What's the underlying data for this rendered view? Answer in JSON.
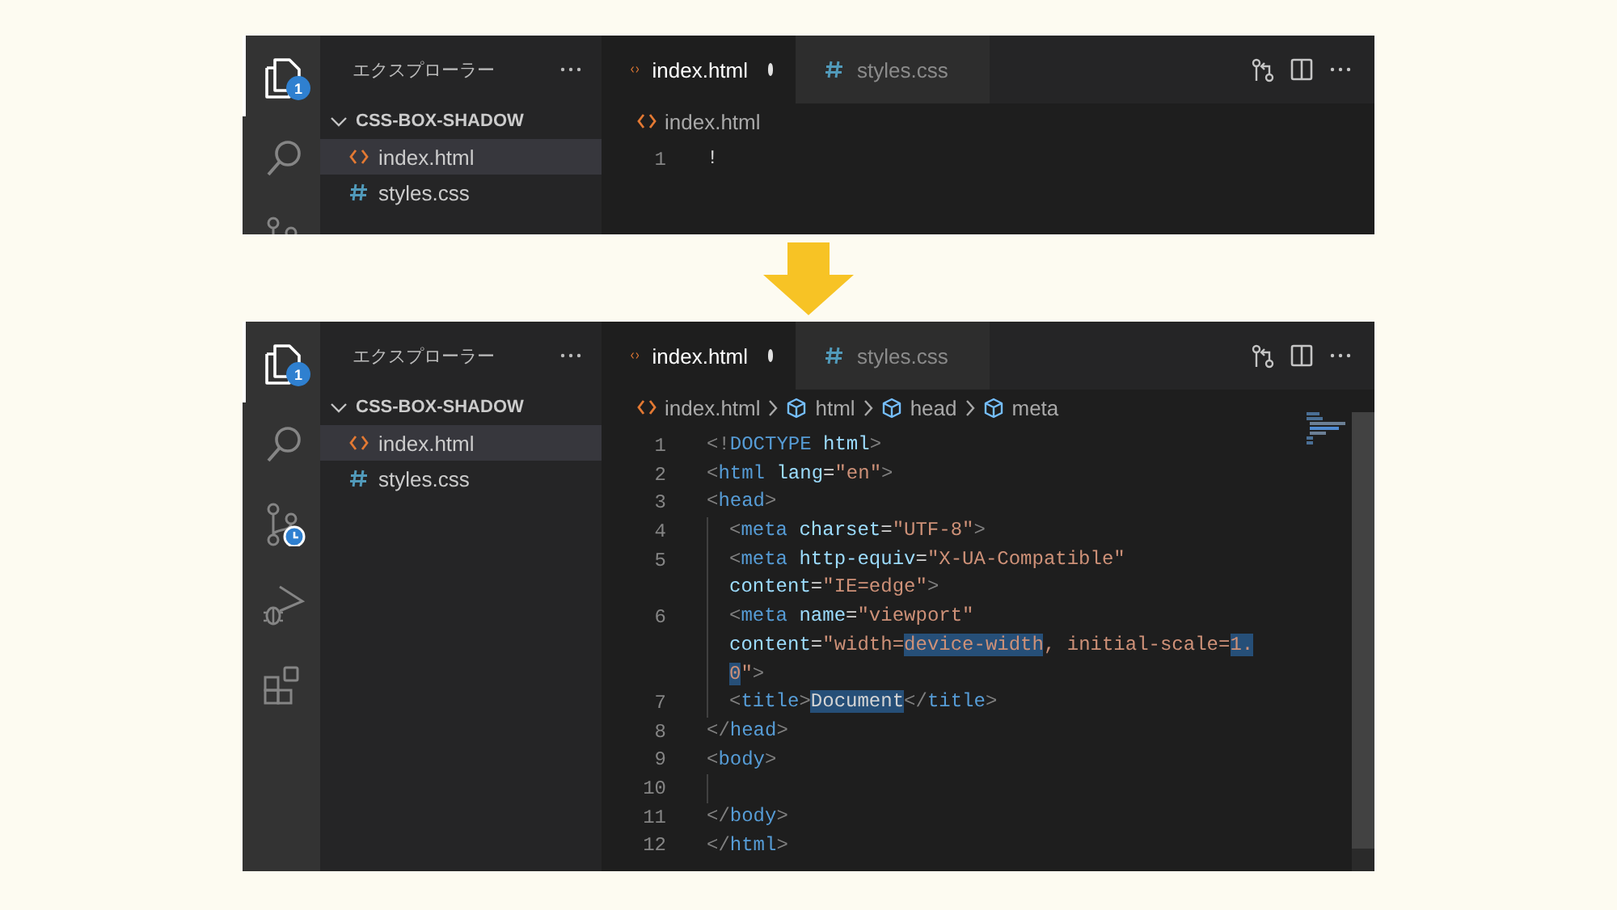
{
  "panels": [
    {
      "activity": [
        {
          "kind": "files",
          "selected": true,
          "badge": "1"
        },
        {
          "kind": "search",
          "selected": false
        },
        {
          "kind": "source-control",
          "selected": false
        }
      ],
      "explorer": {
        "title": "エクスプローラー",
        "folder": "CSS-BOX-SHADOW",
        "expanded": true,
        "files": [
          {
            "name": "index.html",
            "kind": "html",
            "selected": true
          },
          {
            "name": "styles.css",
            "kind": "css",
            "selected": false
          }
        ]
      },
      "tabs": [
        {
          "label": "index.html",
          "kind": "html",
          "selected": true,
          "modified": true
        },
        {
          "label": "styles.css",
          "kind": "css",
          "selected": false,
          "modified": false
        }
      ],
      "breadcrumb": [
        {
          "label": "index.html",
          "kind": "html"
        }
      ],
      "lines": [
        {
          "number": "1",
          "rows": [
            {
              "indented": false,
              "tokens": [
                {
                  "text": "!",
                  "kind": "text",
                  "highlighted": false
                }
              ]
            }
          ]
        }
      ]
    },
    {
      "activity": [
        {
          "kind": "files",
          "selected": true,
          "badge": "1"
        },
        {
          "kind": "search",
          "selected": false
        },
        {
          "kind": "source-control",
          "selected": false
        },
        {
          "kind": "debug",
          "selected": false
        },
        {
          "kind": "extensions",
          "selected": false
        }
      ],
      "explorer": {
        "title": "エクスプローラー",
        "folder": "CSS-BOX-SHADOW",
        "expanded": true,
        "files": [
          {
            "name": "index.html",
            "kind": "html",
            "selected": true
          },
          {
            "name": "styles.css",
            "kind": "css",
            "selected": false
          }
        ]
      },
      "tabs": [
        {
          "label": "index.html",
          "kind": "html",
          "selected": true,
          "modified": true
        },
        {
          "label": "styles.css",
          "kind": "css",
          "selected": false,
          "modified": false
        }
      ],
      "breadcrumb": [
        {
          "label": "index.html",
          "kind": "html"
        },
        {
          "label": "html",
          "kind": "element"
        },
        {
          "label": "head",
          "kind": "element"
        },
        {
          "label": "meta",
          "kind": "element"
        }
      ],
      "lines": [
        {
          "number": "1",
          "rows": [
            {
              "indented": false,
              "tokens": [
                {
                  "text": "<!",
                  "kind": "punct",
                  "highlighted": false
                },
                {
                  "text": "DOCTYPE",
                  "kind": "tag",
                  "highlighted": false
                },
                {
                  "text": " html",
                  "kind": "attr",
                  "highlighted": false
                },
                {
                  "text": ">",
                  "kind": "punct",
                  "highlighted": false
                }
              ]
            }
          ]
        },
        {
          "number": "2",
          "rows": [
            {
              "indented": false,
              "tokens": [
                {
                  "text": "<",
                  "kind": "punct",
                  "highlighted": false
                },
                {
                  "text": "html",
                  "kind": "tag",
                  "highlighted": false
                },
                {
                  "text": " lang",
                  "kind": "attr",
                  "highlighted": false
                },
                {
                  "text": "=",
                  "kind": "text",
                  "highlighted": false
                },
                {
                  "text": "\"en\"",
                  "kind": "string",
                  "highlighted": false
                },
                {
                  "text": ">",
                  "kind": "punct",
                  "highlighted": false
                }
              ]
            }
          ]
        },
        {
          "number": "3",
          "rows": [
            {
              "indented": false,
              "tokens": [
                {
                  "text": "<",
                  "kind": "punct",
                  "highlighted": false
                },
                {
                  "text": "head",
                  "kind": "tag",
                  "highlighted": false
                },
                {
                  "text": ">",
                  "kind": "punct",
                  "highlighted": false
                }
              ]
            }
          ]
        },
        {
          "number": "4",
          "rows": [
            {
              "indented": true,
              "tokens": [
                {
                  "text": "<",
                  "kind": "punct",
                  "highlighted": false
                },
                {
                  "text": "meta",
                  "kind": "tag",
                  "highlighted": false
                },
                {
                  "text": " charset",
                  "kind": "attr",
                  "highlighted": false
                },
                {
                  "text": "=",
                  "kind": "text",
                  "highlighted": false
                },
                {
                  "text": "\"UTF-8\"",
                  "kind": "string",
                  "highlighted": false
                },
                {
                  "text": ">",
                  "kind": "punct",
                  "highlighted": false
                }
              ]
            }
          ]
        },
        {
          "number": "5",
          "rows": [
            {
              "indented": true,
              "tokens": [
                {
                  "text": "<",
                  "kind": "punct",
                  "highlighted": false
                },
                {
                  "text": "meta",
                  "kind": "tag",
                  "highlighted": false
                },
                {
                  "text": " http-equiv",
                  "kind": "attr",
                  "highlighted": false
                },
                {
                  "text": "=",
                  "kind": "text",
                  "highlighted": false
                },
                {
                  "text": "\"X-UA-Compatible\"",
                  "kind": "string",
                  "highlighted": false
                }
              ]
            },
            {
              "indented": true,
              "tokens": [
                {
                  "text": "content",
                  "kind": "attr",
                  "highlighted": false
                },
                {
                  "text": "=",
                  "kind": "text",
                  "highlighted": false
                },
                {
                  "text": "\"IE=edge\"",
                  "kind": "string",
                  "highlighted": false
                },
                {
                  "text": ">",
                  "kind": "punct",
                  "highlighted": false
                }
              ]
            }
          ]
        },
        {
          "number": "6",
          "rows": [
            {
              "indented": true,
              "tokens": [
                {
                  "text": "<",
                  "kind": "punct",
                  "highlighted": false
                },
                {
                  "text": "meta",
                  "kind": "tag",
                  "highlighted": false
                },
                {
                  "text": " name",
                  "kind": "attr",
                  "highlighted": false
                },
                {
                  "text": "=",
                  "kind": "text",
                  "highlighted": false
                },
                {
                  "text": "\"viewport\"",
                  "kind": "string",
                  "highlighted": false
                }
              ]
            },
            {
              "indented": true,
              "tokens": [
                {
                  "text": "content",
                  "kind": "attr",
                  "highlighted": false
                },
                {
                  "text": "=",
                  "kind": "text",
                  "highlighted": false
                },
                {
                  "text": "\"width=",
                  "kind": "string",
                  "highlighted": false
                },
                {
                  "text": "device-width",
                  "kind": "string",
                  "highlighted": true
                },
                {
                  "text": ", initial-scale=",
                  "kind": "string",
                  "highlighted": false
                },
                {
                  "text": "1.",
                  "kind": "string",
                  "highlighted": true
                }
              ]
            },
            {
              "indented": true,
              "tokens": [
                {
                  "text": "0",
                  "kind": "string",
                  "highlighted": true
                },
                {
                  "text": "\"",
                  "kind": "string",
                  "highlighted": false
                },
                {
                  "text": ">",
                  "kind": "punct",
                  "highlighted": false
                }
              ]
            }
          ]
        },
        {
          "number": "7",
          "rows": [
            {
              "indented": true,
              "tokens": [
                {
                  "text": "<",
                  "kind": "punct",
                  "highlighted": false
                },
                {
                  "text": "title",
                  "kind": "tag",
                  "highlighted": false
                },
                {
                  "text": ">",
                  "kind": "punct",
                  "highlighted": false
                },
                {
                  "text": "Document",
                  "kind": "text",
                  "highlighted": true
                },
                {
                  "text": "</",
                  "kind": "punct",
                  "highlighted": false
                },
                {
                  "text": "title",
                  "kind": "tag",
                  "highlighted": false
                },
                {
                  "text": ">",
                  "kind": "punct",
                  "highlighted": false
                }
              ]
            }
          ]
        },
        {
          "number": "8",
          "rows": [
            {
              "indented": false,
              "tokens": [
                {
                  "text": "</",
                  "kind": "punct",
                  "highlighted": false
                },
                {
                  "text": "head",
                  "kind": "tag",
                  "highlighted": false
                },
                {
                  "text": ">",
                  "kind": "punct",
                  "highlighted": false
                }
              ]
            }
          ]
        },
        {
          "number": "9",
          "rows": [
            {
              "indented": false,
              "tokens": [
                {
                  "text": "<",
                  "kind": "punct",
                  "highlighted": false
                },
                {
                  "text": "body",
                  "kind": "tag",
                  "highlighted": false
                },
                {
                  "text": ">",
                  "kind": "punct",
                  "highlighted": false
                }
              ]
            }
          ]
        },
        {
          "number": "10",
          "rows": [
            {
              "indented": true,
              "tokens": []
            }
          ]
        },
        {
          "number": "11",
          "rows": [
            {
              "indented": false,
              "tokens": [
                {
                  "text": "</",
                  "kind": "punct",
                  "highlighted": false
                },
                {
                  "text": "body",
                  "kind": "tag",
                  "highlighted": false
                },
                {
                  "text": ">",
                  "kind": "punct",
                  "highlighted": false
                }
              ]
            }
          ]
        },
        {
          "number": "12",
          "rows": [
            {
              "indented": false,
              "tokens": [
                {
                  "text": "</",
                  "kind": "punct",
                  "highlighted": false
                },
                {
                  "text": "html",
                  "kind": "tag",
                  "highlighted": false
                },
                {
                  "text": ">",
                  "kind": "punct",
                  "highlighted": false
                }
              ]
            }
          ]
        }
      ]
    }
  ]
}
